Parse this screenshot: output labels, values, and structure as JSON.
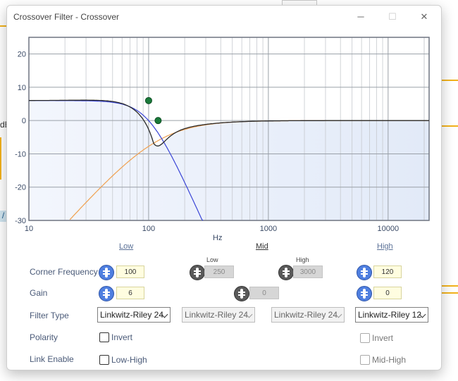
{
  "window": {
    "title": "Crossover Filter - Crossover",
    "minimize_icon": "minimize-icon",
    "maximize_icon": "maximize-icon",
    "close_icon": "close-icon"
  },
  "background": {
    "tag_text": "/",
    "db_text": "dB"
  },
  "plot": {
    "y_ticks": [
      "20",
      "10",
      "0",
      "-10",
      "-20",
      "-30"
    ],
    "x_ticks": [
      "10",
      "100",
      "1000",
      "10000"
    ],
    "x_unit": "Hz",
    "colors": {
      "combined": "#2a2a2a",
      "low": "#3a45d6",
      "high": "#f0a050",
      "handle": "#1a7a3a",
      "fill": "#eaf0fb"
    }
  },
  "bands": {
    "low": "Low",
    "mid": "Mid",
    "high": "High"
  },
  "rows": {
    "corner_frequency": "Corner Frequency",
    "gain": "Gain",
    "filter_type": "Filter Type",
    "polarity": "Polarity",
    "link_enable": "Link Enable"
  },
  "mid_sub": {
    "low": "Low",
    "high": "High"
  },
  "values": {
    "low_freq": "100",
    "mid_low_freq": "250",
    "mid_high_freq": "3000",
    "high_freq": "120",
    "low_gain": "6",
    "mid_gain": "0",
    "high_gain": "0"
  },
  "filter_types": {
    "low": "Linkwitz-Riley 24",
    "mid_low": "Linkwitz-Riley 24",
    "mid_high": "Linkwitz-Riley 24",
    "high": "Linkwitz-Riley 12"
  },
  "checkboxes": {
    "invert_low": "Invert",
    "invert_high": "Invert",
    "link_low_high": "Low-High",
    "link_mid_high": "Mid-High"
  }
}
